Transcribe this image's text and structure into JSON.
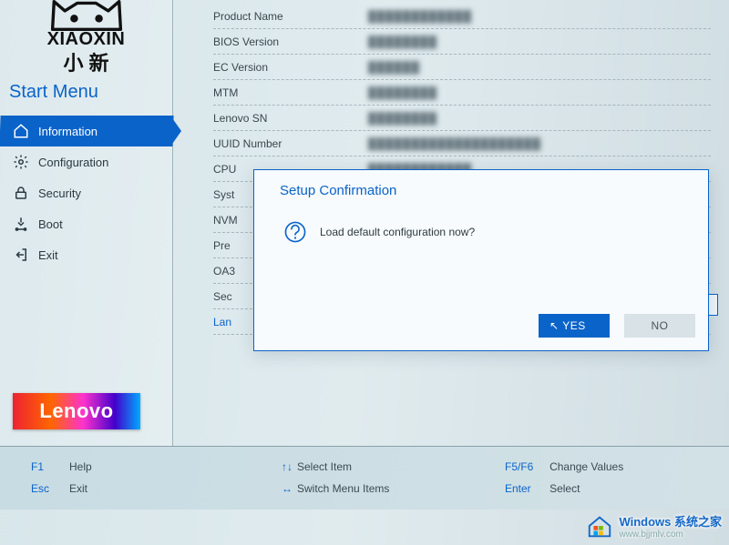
{
  "brand": {
    "name": "XIAOXIN",
    "cn": "小 新",
    "start_menu": "Start Menu"
  },
  "nav": {
    "information": "Information",
    "configuration": "Configuration",
    "security": "Security",
    "boot": "Boot",
    "exit": "Exit"
  },
  "fields": {
    "product_name": {
      "label": "Product Name",
      "value": "████████████"
    },
    "bios_version": {
      "label": "BIOS Version",
      "value": "████████"
    },
    "ec_version": {
      "label": "EC Version",
      "value": "██████"
    },
    "mtm": {
      "label": "MTM",
      "value": "████████"
    },
    "lenovo_sn": {
      "label": "Lenovo SN",
      "value": "████████"
    },
    "uuid_number": {
      "label": "UUID Number",
      "value": "████████████████████"
    },
    "cpu": {
      "label": "CPU",
      "value": "████████████"
    },
    "sys": {
      "label": "Syst",
      "value": ""
    },
    "nvme": {
      "label": "NVM",
      "value": ""
    },
    "pre": {
      "label": "Pre",
      "value": ""
    },
    "oa3": {
      "label": "OA3",
      "value": ""
    },
    "sec": {
      "label": "Sec",
      "value": ""
    },
    "language": {
      "label": "Lan",
      "value": ""
    }
  },
  "modal": {
    "title": "Setup Confirmation",
    "message": "Load default configuration now?",
    "yes": "YES",
    "no": "NO"
  },
  "footer": {
    "f1": {
      "key": "F1",
      "label": "Help"
    },
    "esc": {
      "key": "Esc",
      "label": "Exit"
    },
    "select_item": "Select Item",
    "switch_menu": "Switch Menu Items",
    "f5f6": {
      "key": "F5/F6",
      "label": "Change Values"
    },
    "enter": {
      "key": "Enter",
      "label": "Select"
    }
  },
  "logo": {
    "text": "Lenovo"
  },
  "watermark": {
    "line1": "Windows 系统之家",
    "line2": "www.bjjmlv.com"
  }
}
